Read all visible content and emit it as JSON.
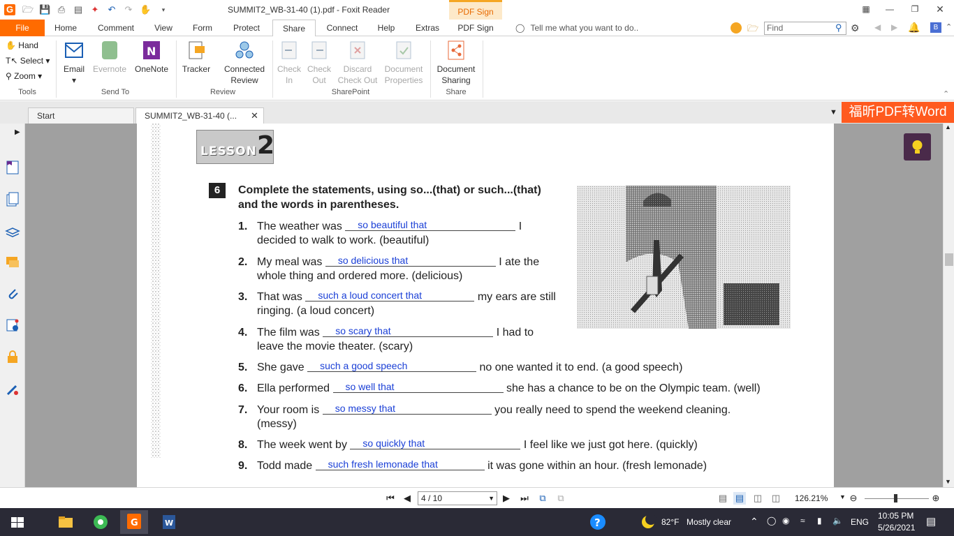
{
  "window": {
    "title": "SUMMIT2_WB-31-40 (1).pdf - Foxit Reader",
    "context_tab": "PDF Sign"
  },
  "menu": {
    "file": "File",
    "tabs": [
      "Home",
      "Comment",
      "View",
      "Form",
      "Protect",
      "Share",
      "Connect",
      "Help",
      "Extras",
      "PDF Sign"
    ],
    "active_tab": "Share",
    "tell_me": "Tell me what you want to do..",
    "find_placeholder": "Find"
  },
  "ribbon": {
    "tools": {
      "hand": "Hand",
      "select": "Select",
      "zoom": "Zoom",
      "label": "Tools"
    },
    "send_to": {
      "email": "Email",
      "evernote": "Evernote",
      "onenote": "OneNote",
      "label": "Send To"
    },
    "review": {
      "tracker": "Tracker",
      "connected_1": "Connected",
      "connected_2": "Review",
      "label": "Review"
    },
    "sharepoint": {
      "check_in_1": "Check",
      "check_in_2": "In",
      "check_out_1": "Check",
      "check_out_2": "Out",
      "discard_1": "Discard",
      "discard_2": "Check Out",
      "docprops_1": "Document",
      "docprops_2": "Properties",
      "label": "SharePoint"
    },
    "share": {
      "doc_sharing_1": "Document",
      "doc_sharing_2": "Sharing",
      "label": "Share"
    }
  },
  "doc_tabs": {
    "start": "Start",
    "file": "SUMMIT2_WB-31-40 (..."
  },
  "banner": "福昕PDF转Word",
  "document": {
    "lesson_word": "LESSON",
    "lesson_num": "2",
    "exercise_num": "6",
    "instruction_1": "Complete the statements, using so...(that) or such...(that)",
    "instruction_2": "and the words in parentheses.",
    "items": [
      {
        "n": "1.",
        "pre": "The weather was",
        "answer": "so beautiful that",
        "post": "I",
        "cont": "decided to walk to work. (beautiful)"
      },
      {
        "n": "2.",
        "pre": "My meal was",
        "answer": "so delicious that",
        "post": "I ate the",
        "cont": "whole thing and ordered more. (delicious)"
      },
      {
        "n": "3.",
        "pre": "That was",
        "answer": "such a loud concert that",
        "post": "my ears are still",
        "cont": "ringing. (a loud concert)"
      },
      {
        "n": "4.",
        "pre": "The film was",
        "answer": "so scary that",
        "post": "I had to",
        "cont": "leave the movie theater. (scary)"
      },
      {
        "n": "5.",
        "pre": "She gave",
        "answer": "such a good speech",
        "post": "no one wanted it to end. (a good speech)",
        "cont": ""
      },
      {
        "n": "6.",
        "pre": "Ella performed",
        "answer": "so well that",
        "post": "she has a chance to be on the Olympic team. (well)",
        "cont": ""
      },
      {
        "n": "7.",
        "pre": "Your room is",
        "answer": "so messy that",
        "post": "you really need to spend the weekend cleaning.",
        "cont": "(messy)"
      },
      {
        "n": "8.",
        "pre": "The week went by",
        "answer": "so quickly that",
        "post": "I feel like we just got here. (quickly)",
        "cont": ""
      },
      {
        "n": "9.",
        "pre": "Todd made",
        "answer": "such fresh lemonade that",
        "post": "it was gone within an hour. (fresh lemonade)",
        "cont": ""
      }
    ]
  },
  "status": {
    "page": "4 / 10",
    "zoom": "126.21%"
  },
  "taskbar": {
    "weather_temp": "82°F",
    "weather_text": "Mostly clear",
    "lang": "ENG",
    "time": "10:05 PM",
    "date": "5/26/2021"
  },
  "colors": {
    "accent": "#ff6b00",
    "answer_blue": "#1a3fd6",
    "banner": "#ff5a1f"
  }
}
